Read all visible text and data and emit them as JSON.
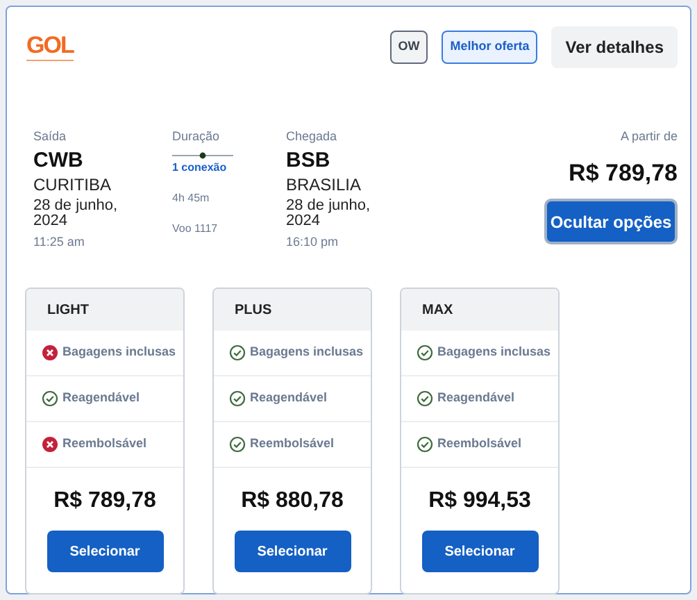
{
  "logo": {
    "text": "GOL"
  },
  "badges": [
    {
      "label": "OW",
      "kind": "neutral"
    },
    {
      "label": "Melhor oferta",
      "kind": "highlight"
    }
  ],
  "details_button": "Ver detalhes",
  "departure": {
    "label": "Saída",
    "code": "CWB",
    "city": "CURITIBA",
    "date": "28 de junho, 2024",
    "time": "11:25 am"
  },
  "duration": {
    "label": "Duração",
    "stops": "1 conexão",
    "time": "4h 45m",
    "flight": "Voo 1117"
  },
  "arrival": {
    "label": "Chegada",
    "code": "BSB",
    "city": "BRASILIA",
    "date": "28 de junho, 2024",
    "time": "16:10 pm"
  },
  "price": {
    "label": "A partir de",
    "value": "R$ 789,78"
  },
  "toggle_button": "Ocultar opções",
  "fares": [
    {
      "name": "LIGHT",
      "features": [
        {
          "label": "Bagagens inclusas",
          "included": false
        },
        {
          "label": "Reagendável",
          "included": true
        },
        {
          "label": "Reembolsável",
          "included": false
        }
      ],
      "price": "R$ 789,78",
      "button": "Selecionar"
    },
    {
      "name": "PLUS",
      "features": [
        {
          "label": "Bagagens inclusas",
          "included": true
        },
        {
          "label": "Reagendável",
          "included": true
        },
        {
          "label": "Reembolsável",
          "included": true
        }
      ],
      "price": "R$ 880,78",
      "button": "Selecionar"
    },
    {
      "name": "MAX",
      "features": [
        {
          "label": "Bagagens inclusas",
          "included": true
        },
        {
          "label": "Reagendável",
          "included": true
        },
        {
          "label": "Reembolsável",
          "included": true
        }
      ],
      "price": "R$ 994,53",
      "button": "Selecionar"
    }
  ]
}
